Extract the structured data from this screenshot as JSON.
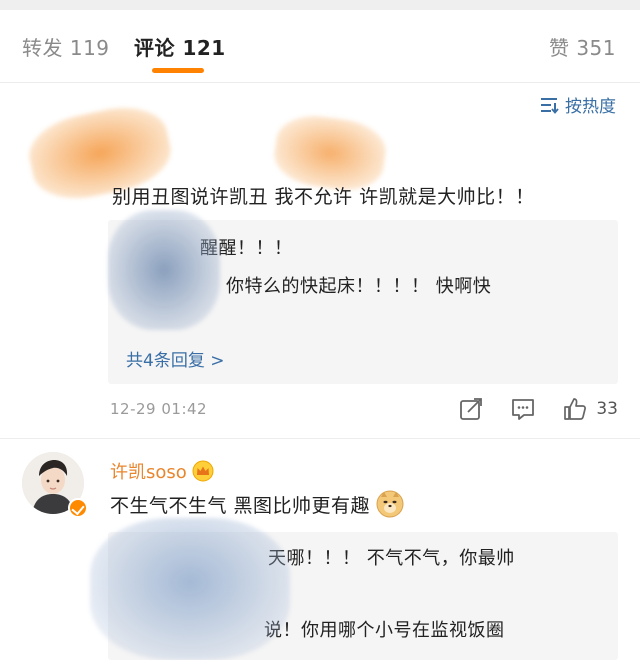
{
  "tabs": {
    "repost": "转发 119",
    "comments": "评论 121",
    "likes": "赞 351"
  },
  "sort": {
    "label": "按热度",
    "icon": "sort-icon"
  },
  "comment1": {
    "text": "别用丑图说许凯丑 我不允许 许凯就是大帅比！！",
    "replies": [
      "醒醒！！！",
      "你特么的快起床！！！！ 快啊快"
    ],
    "more_replies": "共4条回复 >",
    "time": "12-29 01:42",
    "likes": "33"
  },
  "comment2": {
    "username": "许凯soso",
    "text": "不生气不生气 黑图比帅更有趣",
    "emoji": "doge-emoji",
    "replies": [
      "天哪！！！ 不气不气，你最帅",
      "说！你用哪个小号在监视饭圈"
    ]
  },
  "colors": {
    "accent": "#ff8200",
    "link": "#3a6fa6",
    "username": "#e8862e",
    "reply_bg": "#f5f5f5",
    "muted": "#9a9a9a"
  }
}
